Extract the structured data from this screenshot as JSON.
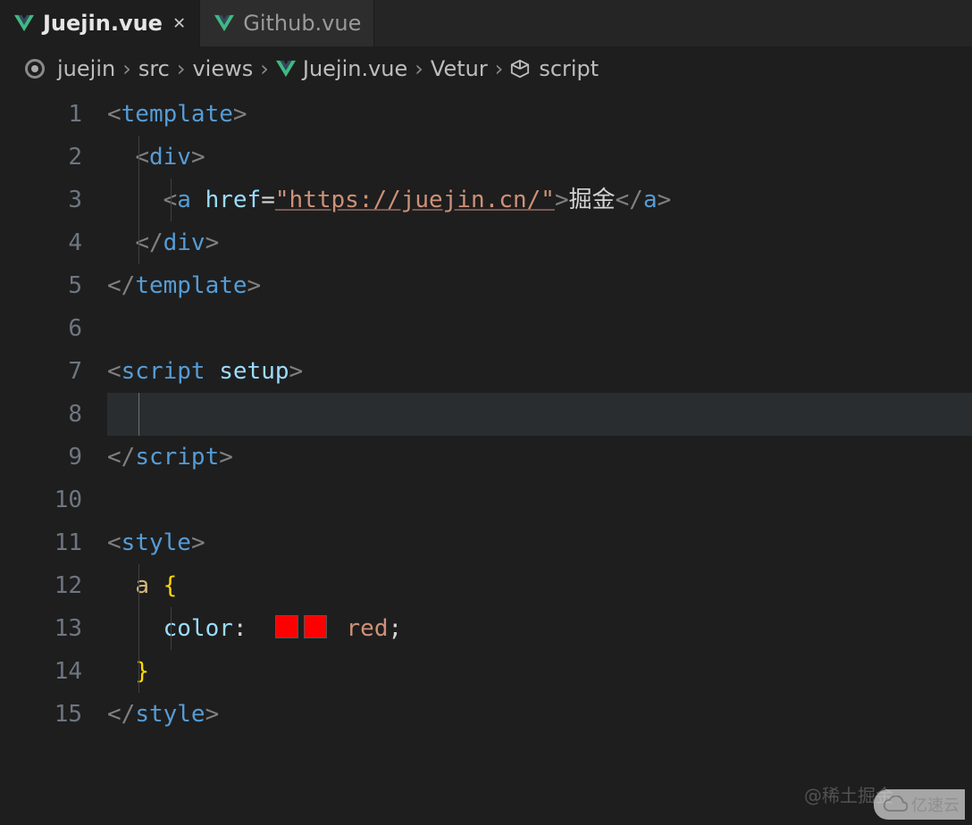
{
  "tabs": {
    "active": {
      "label": "Juejin.vue"
    },
    "other": {
      "label": "Github.vue"
    }
  },
  "breadcrumb": {
    "p0": "juejin",
    "p1": "src",
    "p2": "views",
    "p3": "Juejin.vue",
    "p4": "Vetur",
    "p5": "script"
  },
  "code": {
    "line_numbers": [
      "1",
      "2",
      "3",
      "4",
      "5",
      "6",
      "7",
      "8",
      "9",
      "10",
      "11",
      "12",
      "13",
      "14",
      "15"
    ],
    "tags": {
      "template": "template",
      "div": "div",
      "a": "a",
      "script": "script",
      "setup": "setup",
      "style": "style"
    },
    "attrs": {
      "href": "href"
    },
    "href_value": "\"https://juejin.cn/\"",
    "link_text": "掘金",
    "css": {
      "selector": "a",
      "open_brace": "{",
      "close_brace": "}",
      "prop": "color",
      "colon": ":",
      "value": "red",
      "semicolon": ";",
      "swatch_color": "#ff0000"
    }
  },
  "punct": {
    "lt": "<",
    "gt": ">",
    "slash": "/",
    "eq": "=",
    "caret_right": "›"
  },
  "watermark": {
    "author": "@稀土掘金",
    "brand": "亿速云"
  }
}
